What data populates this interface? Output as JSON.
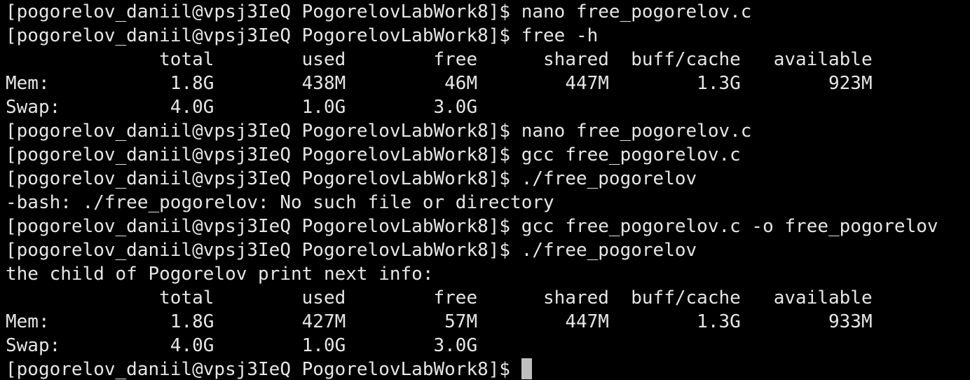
{
  "terminal": {
    "prompt": "[pogorelov_daniil@vpsj3IeQ PogorelovLabWork8]$",
    "colors": {
      "background": "#000000",
      "foreground": "#e6e6e6",
      "cursor": "#bfbfbf"
    },
    "lines": [
      "[pogorelov_daniil@vpsj3IeQ PogorelovLabWork8]$ nano free_pogorelov.c",
      "[pogorelov_daniil@vpsj3IeQ PogorelovLabWork8]$ free -h",
      "              total        used        free      shared  buff/cache   available",
      "Mem:           1.8G        438M         46M        447M        1.3G        923M",
      "Swap:          4.0G        1.0G        3.0G",
      "[pogorelov_daniil@vpsj3IeQ PogorelovLabWork8]$ nano free_pogorelov.c",
      "[pogorelov_daniil@vpsj3IeQ PogorelovLabWork8]$ gcc free_pogorelov.c",
      "[pogorelov_daniil@vpsj3IeQ PogorelovLabWork8]$ ./free_pogorelov",
      "-bash: ./free_pogorelov: No such file or directory",
      "[pogorelov_daniil@vpsj3IeQ PogorelovLabWork8]$ gcc free_pogorelov.c -o free_pogorelov",
      "[pogorelov_daniil@vpsj3IeQ PogorelovLabWork8]$ ./free_pogorelov",
      "the child of Pogorelov print next info:",
      "              total        used        free      shared  buff/cache   available",
      "Mem:           1.8G        427M         57M        447M        1.3G        933M",
      "Swap:          4.0G        1.0G        3.0G"
    ],
    "current_prompt": "[pogorelov_daniil@vpsj3IeQ PogorelovLabWork8]$ "
  }
}
